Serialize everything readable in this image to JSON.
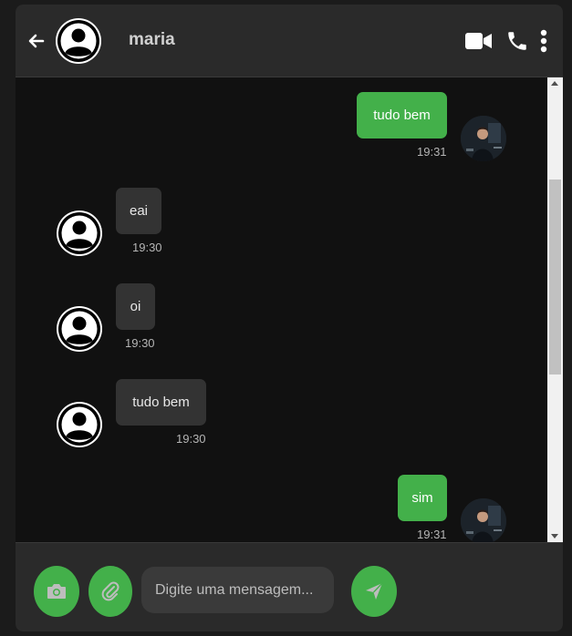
{
  "header": {
    "contact_name": "maria"
  },
  "messages": [
    {
      "direction": "sent",
      "text": "tudo bem",
      "time": "19:31"
    },
    {
      "direction": "received",
      "text": "eai",
      "time": "19:30"
    },
    {
      "direction": "received",
      "text": "oi",
      "time": "19:30"
    },
    {
      "direction": "received",
      "text": "tudo bem",
      "time": "19:30"
    },
    {
      "direction": "sent",
      "text": "sim",
      "time": "19:31"
    }
  ],
  "composer": {
    "placeholder": "Digite uma mensagem..."
  },
  "colors": {
    "accent": "#43b04a",
    "header_bg": "#2a2a2a",
    "chat_bg": "#111111",
    "received_bubble": "#333333"
  },
  "icons": {
    "back": "arrow-left-icon",
    "video": "video-camera-icon",
    "phone": "phone-icon",
    "more": "more-vertical-icon",
    "camera": "camera-icon",
    "attach": "paperclip-icon",
    "send": "send-icon",
    "avatar": "user-avatar-icon"
  }
}
